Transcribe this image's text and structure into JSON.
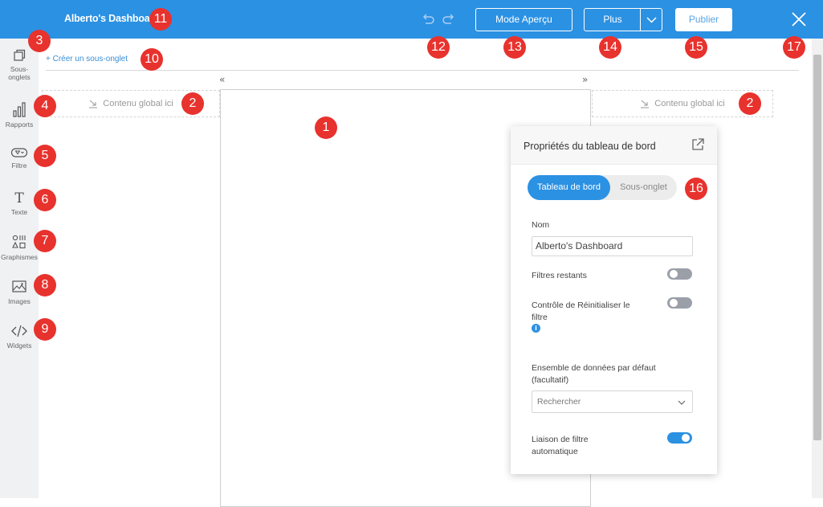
{
  "topbar": {
    "title": "Alberto's Dashboard",
    "preview_label": "Mode Aperçu",
    "more_label": "Plus",
    "publish_label": "Publier"
  },
  "sidebar": {
    "items": [
      {
        "label": "Sous-\nonglets",
        "icon": "subtabs-icon"
      },
      {
        "label": "Rapports",
        "icon": "bar-chart-icon"
      },
      {
        "label": "Filtre",
        "icon": "filter-icon"
      },
      {
        "label": "Texte",
        "icon": "text-icon"
      },
      {
        "label": "Graphismes",
        "icon": "shapes-icon"
      },
      {
        "label": "Images",
        "icon": "image-icon"
      },
      {
        "label": "Widgets",
        "icon": "code-icon"
      }
    ]
  },
  "canvas": {
    "create_subtab": "+ Créer un sous-onglet",
    "global_left": "Contenu global ici",
    "global_right": "Contenu global ici",
    "collapse_left": "«",
    "collapse_right": "»"
  },
  "panel": {
    "title": "Propriétés du tableau de bord",
    "tab_dashboard": "Tableau de bord",
    "tab_subtab": "Sous-onglet",
    "name_label": "Nom",
    "name_value": "Alberto's Dashboard",
    "remaining_filters_label": "Filtres restants",
    "remaining_filters_on": false,
    "reset_control_label": "Contrôle de Réinitialiser le filtre",
    "reset_control_on": false,
    "info_glyph": "i",
    "dataset_label": "Ensemble de données par défaut (facultatif)",
    "dataset_placeholder": "Rechercher",
    "auto_link_label": "Liaison de filtre automatique",
    "auto_link_on": true
  },
  "badges": [
    "1",
    "2",
    "2",
    "3",
    "4",
    "5",
    "6",
    "7",
    "8",
    "9",
    "10",
    "11",
    "12",
    "13",
    "14",
    "15",
    "16",
    "17"
  ],
  "colors": {
    "brand_blue": "#2b91e3",
    "badge_red": "#e8322d",
    "sidebar_bg": "#eff1f3"
  }
}
